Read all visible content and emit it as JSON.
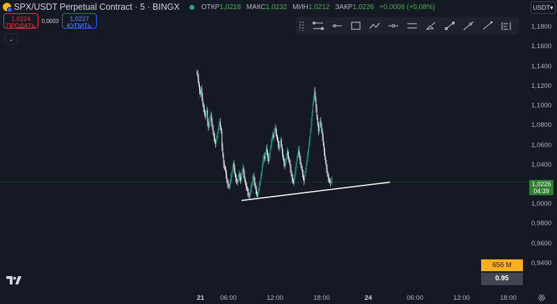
{
  "header": {
    "title": "SPX/USDT Perpetual Contract · 5 · BINGX",
    "ohlc": [
      {
        "label": "ОТКР",
        "value": "1,0218"
      },
      {
        "label": "МАКС",
        "value": "1,0232"
      },
      {
        "label": "МИН",
        "value": "1,0212"
      },
      {
        "label": "ЗАКР",
        "value": "1,0226"
      }
    ],
    "change": "+0,0008 (+0,08%)"
  },
  "trade": {
    "sell_price": "1,0224",
    "sell_label": "ПРОДАТЬ",
    "spread": "0,0003",
    "buy_price": "1,0227",
    "buy_label": "КУПИТЬ"
  },
  "currency": "USDT",
  "toolbar_icons": [
    "parallel-channel-icon",
    "horizontal-line-icon",
    "rectangle-icon",
    "path-icon",
    "horizontal-ray-icon",
    "info-line-icon",
    "brush-icon",
    "trend-angle-icon",
    "extended-line-icon",
    "trend-line-icon",
    "fib-retracement-icon"
  ],
  "yaxis_labels": [
    "1,1800",
    "1,1600",
    "1,1400",
    "1,1200",
    "1,1000",
    "1,0800",
    "1,0600",
    "1,0400",
    "1,0000",
    "0,9800",
    "0,9600",
    "0,9400"
  ],
  "xaxis": [
    {
      "label": "21",
      "bold": true
    },
    {
      "label": "06:00"
    },
    {
      "label": "12:00"
    },
    {
      "label": "18:00"
    },
    {
      "label": "24",
      "bold": true
    },
    {
      "label": "06:00"
    },
    {
      "label": "12:00"
    },
    {
      "label": "18:00"
    }
  ],
  "price_tag": {
    "price": "1,0226",
    "countdown": "04:39"
  },
  "volume_tag": "656 M",
  "indicator_tag": "0.95",
  "colors": {
    "up": "#26a69a",
    "down": "#ffffff",
    "line": "#ffffff",
    "price": "#2e7d32",
    "volume": "#f9b01b"
  },
  "chart_data": {
    "type": "candlestick",
    "ylim": [
      0.93,
      1.19
    ],
    "close": [
      1.133,
      1.128,
      1.122,
      1.116,
      1.112,
      1.118,
      1.109,
      1.102,
      1.098,
      1.094,
      1.089,
      1.092,
      1.096,
      1.084,
      1.078,
      1.082,
      1.087,
      1.091,
      1.084,
      1.079,
      1.072,
      1.068,
      1.064,
      1.062,
      1.066,
      1.071,
      1.075,
      1.08,
      1.084,
      1.079,
      1.074,
      1.058,
      1.05,
      1.041,
      1.038,
      1.035,
      1.03,
      1.024,
      1.021,
      1.019,
      1.018,
      1.023,
      1.027,
      1.031,
      1.036,
      1.042,
      1.036,
      1.03,
      1.027,
      1.024,
      1.022,
      1.026,
      1.031,
      1.028,
      1.024,
      1.029,
      1.033,
      1.037,
      1.031,
      1.026,
      1.021,
      1.018,
      1.016,
      1.013,
      1.01,
      1.008,
      1.012,
      1.017,
      1.021,
      1.026,
      1.029,
      1.023,
      1.019,
      1.015,
      1.011,
      1.009,
      1.013,
      1.018,
      1.022,
      1.027,
      1.033,
      1.039,
      1.045,
      1.049,
      1.046,
      1.052,
      1.057,
      1.053,
      1.048,
      1.044,
      1.051,
      1.057,
      1.062,
      1.067,
      1.071,
      1.068,
      1.074,
      1.078,
      1.073,
      1.069,
      1.065,
      1.06,
      1.057,
      1.062,
      1.066,
      1.058,
      1.052,
      1.047,
      1.043,
      1.039,
      1.045,
      1.049,
      1.054,
      1.05,
      1.046,
      1.042,
      1.036,
      1.031,
      1.027,
      1.024,
      1.022,
      1.028,
      1.034,
      1.04,
      1.046,
      1.051,
      1.055,
      1.05,
      1.045,
      1.04,
      1.036,
      1.031,
      1.027,
      1.024,
      1.03,
      1.036,
      1.042,
      1.048,
      1.054,
      1.06,
      1.067,
      1.075,
      1.084,
      1.093,
      1.102,
      1.11,
      1.115,
      1.107,
      1.098,
      1.089,
      1.081,
      1.074,
      1.079,
      1.085,
      1.081,
      1.074,
      1.068,
      1.061,
      1.054,
      1.048,
      1.042,
      1.036,
      1.031,
      1.027,
      1.025,
      1.023,
      1.022,
      1.024,
      1.026
    ],
    "trendline": {
      "start": {
        "index": 0.28,
        "value": 1.004
      },
      "end": {
        "index": 1.0,
        "value": 1.0226
      }
    }
  }
}
